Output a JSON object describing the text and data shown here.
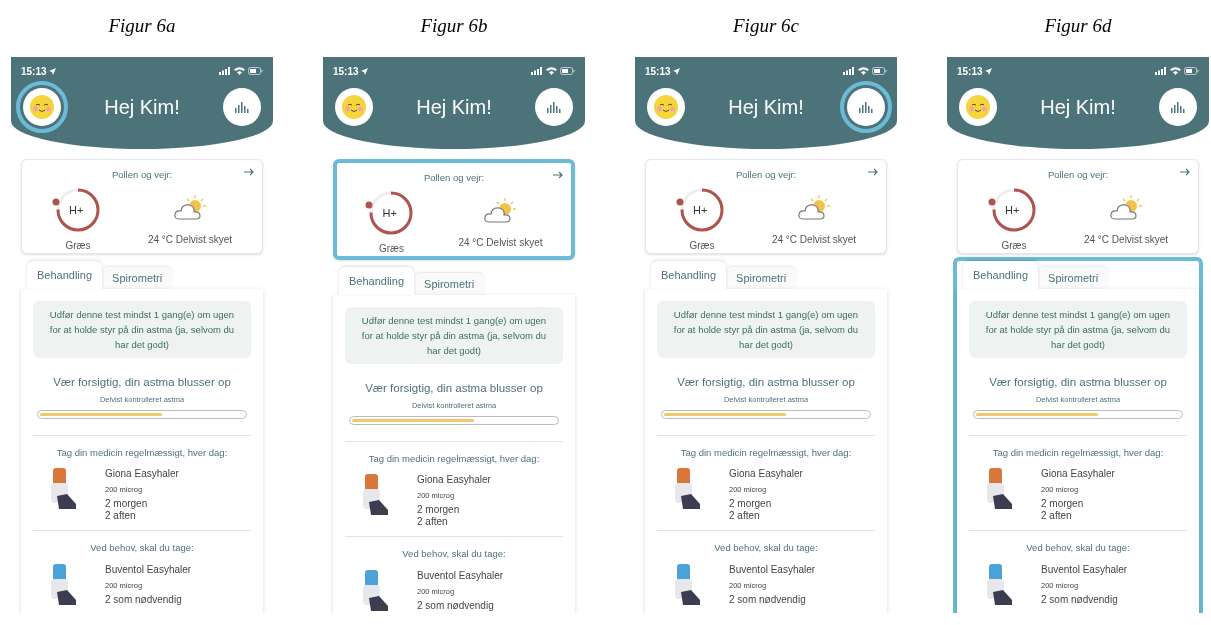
{
  "figures": [
    {
      "caption": "Figur 6a",
      "status_time": "15:13",
      "avatar_highlighted": true,
      "greeting": "Hej Kim!",
      "stats_highlighted": false,
      "pollen": {
        "highlighted": false,
        "title": "Pollen og vejr:",
        "badge": "H+",
        "label": "Græs",
        "weather": "24 °C Delvist skyet"
      },
      "tabs_highlighted": false,
      "tabs": [
        {
          "label": "Behandling",
          "selected": true
        },
        {
          "label": "Spirometri",
          "selected": false
        }
      ],
      "notice": "Udfør denne test mindst 1 gang(e) om ugen for at holde styr på din astma (ja, selvom du har det godt)",
      "asthma": {
        "title": "Vær forsigtig, din astma blusser op",
        "subtitle": "Delvist kontrolleret astma",
        "level": 0.6
      },
      "medicine_sections": [
        {
          "heading": "Tag din medicin regelmæssigt, hver dag:",
          "name": "Giona Easyhaler",
          "dose": "200 microg",
          "schedule": [
            "2 morgen",
            "2 aften"
          ],
          "color": "#d9773a"
        },
        {
          "heading": "Ved behov, skal du tage:",
          "name": "Buventol Easyhaler",
          "dose": "200 microg",
          "schedule": [
            "2 som nødvendig"
          ],
          "color": "#4ba3d9"
        }
      ]
    },
    {
      "caption": "Figur 6b",
      "status_time": "15:13",
      "avatar_highlighted": false,
      "greeting": "Hej Kim!",
      "stats_highlighted": false,
      "pollen": {
        "highlighted": true,
        "title": "Pollen og vejr:",
        "badge": "H+",
        "label": "Græs",
        "weather": "24 °C Delvist skyet"
      },
      "tabs_highlighted": false,
      "tabs": [
        {
          "label": "Behandling",
          "selected": true
        },
        {
          "label": "Spirometri",
          "selected": false
        }
      ],
      "notice": "Udfør denne test mindst 1 gang(e) om ugen for at holde styr på din astma (ja, selvom du har det godt)",
      "asthma": {
        "title": "Vær forsigtig, din astma blusser op",
        "subtitle": "Delvist kontrolleret astma",
        "level": 0.6
      },
      "medicine_sections": [
        {
          "heading": "Tag din medicin regelmæssigt, hver dag:",
          "name": "Giona Easyhaler",
          "dose": "200 microg",
          "schedule": [
            "2 morgen",
            "2 aften"
          ],
          "color": "#d9773a"
        },
        {
          "heading": "Ved behov, skal du tage:",
          "name": "Buventol Easyhaler",
          "dose": "200 microg",
          "schedule": [
            "2 som nødvendig"
          ],
          "color": "#4ba3d9"
        }
      ]
    },
    {
      "caption": "Figur 6c",
      "status_time": "15:13",
      "avatar_highlighted": false,
      "greeting": "Hej Kim!",
      "stats_highlighted": true,
      "pollen": {
        "highlighted": false,
        "title": "Pollen og vejr:",
        "badge": "H+",
        "label": "Græs",
        "weather": "24 °C Delvist skyet"
      },
      "tabs_highlighted": false,
      "tabs": [
        {
          "label": "Behandling",
          "selected": true
        },
        {
          "label": "Spirometri",
          "selected": false
        }
      ],
      "notice": "Udfør denne test mindst 1 gang(e) om ugen for at holde styr på din astma (ja, selvom du har det godt)",
      "asthma": {
        "title": "Vær forsigtig, din astma blusser op",
        "subtitle": "Delvist kontrolleret astma",
        "level": 0.6
      },
      "medicine_sections": [
        {
          "heading": "Tag din medicin regelmæssigt, hver dag:",
          "name": "Giona Easyhaler",
          "dose": "200 microg",
          "schedule": [
            "2 morgen",
            "2 aften"
          ],
          "color": "#d9773a"
        },
        {
          "heading": "Ved behov, skal du tage:",
          "name": "Buventol Easyhaler",
          "dose": "200 microg",
          "schedule": [
            "2 som nødvendig"
          ],
          "color": "#4ba3d9"
        }
      ]
    },
    {
      "caption": "Figur 6d",
      "status_time": "15:13",
      "avatar_highlighted": false,
      "greeting": "Hej Kim!",
      "stats_highlighted": false,
      "pollen": {
        "highlighted": false,
        "title": "Pollen og vejr:",
        "badge": "H+",
        "label": "Græs",
        "weather": "24 °C Delvist skyet"
      },
      "tabs_highlighted": true,
      "tabs": [
        {
          "label": "Behandling",
          "selected": true
        },
        {
          "label": "Spirometri",
          "selected": false
        }
      ],
      "notice": "Udfør denne test mindst 1 gang(e) om ugen for at holde styr på din astma (ja, selvom du har det godt)",
      "asthma": {
        "title": "Vær forsigtig, din astma blusser op",
        "subtitle": "Delvist kontrolleret astma",
        "level": 0.6
      },
      "medicine_sections": [
        {
          "heading": "Tag din medicin regelmæssigt, hver dag:",
          "name": "Giona Easyhaler",
          "dose": "200 microg",
          "schedule": [
            "2 morgen",
            "2 aften"
          ],
          "color": "#d9773a"
        },
        {
          "heading": "Ved behov, skal du tage:",
          "name": "Buventol Easyhaler",
          "dose": "200 microg",
          "schedule": [
            "2 som nødvendig"
          ],
          "color": "#4ba3d9"
        }
      ]
    }
  ]
}
